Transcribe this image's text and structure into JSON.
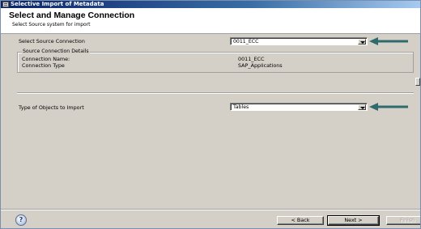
{
  "window": {
    "title": "Selective Import of Metadata"
  },
  "header": {
    "title": "Select and Manage Connection",
    "subtitle": "Select Source system for import"
  },
  "form": {
    "source_connection_label": "Select Source Connection",
    "source_connection_value": "0011_ECC",
    "details_group_label": "Source Connection Details",
    "connection_name_label": "Connection Name:",
    "connection_name_value": "0011_ECC",
    "connection_type_label": "Connection Type",
    "connection_type_value": "SAP_Applications",
    "objects_label": "Type of Objects to Import",
    "objects_value": "Tables"
  },
  "buttons": {
    "back": "< Back",
    "next": "Next >",
    "finish": "Finish",
    "help": "?"
  },
  "colors": {
    "annotation_arrow": "#2f6b6e",
    "title_bar": "#0a246a"
  },
  "icons": {
    "help": "help-icon",
    "dropdown": "chevron-down-icon",
    "arrow": "annotation-arrow"
  }
}
